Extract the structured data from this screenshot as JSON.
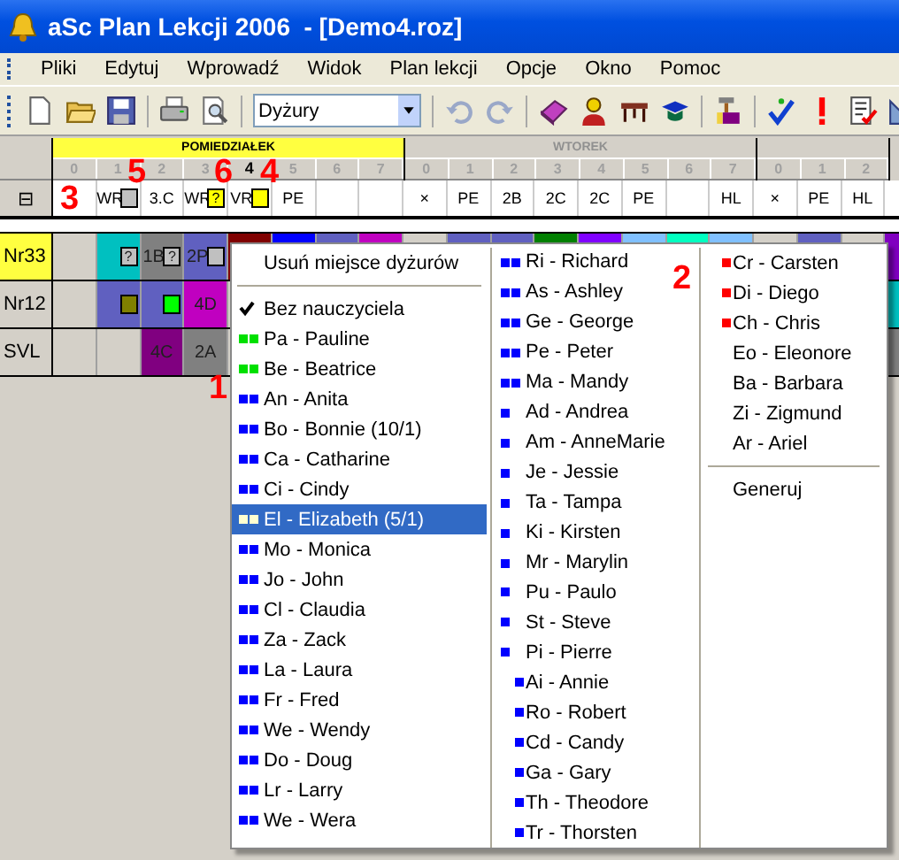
{
  "window": {
    "title": "aSc Plan Lekcji 2006  - [Demo4.roz]"
  },
  "menu_bar": [
    "Pliki",
    "Edytuj",
    "Wprowadź",
    "Widok",
    "Plan lekcji",
    "Opcje",
    "Okno",
    "Pomoc"
  ],
  "toolbar": {
    "view_select": {
      "value": "Dyżury"
    }
  },
  "days": [
    {
      "name": "POMIEDZIAŁEK",
      "selected": true,
      "periods": [
        {
          "label": "0",
          "selected": false
        },
        {
          "label": "1",
          "selected": false
        },
        {
          "label": "2",
          "selected": false
        },
        {
          "label": "3",
          "selected": false
        },
        {
          "label": "4",
          "selected": true
        },
        {
          "label": "5",
          "selected": false
        },
        {
          "label": "6",
          "selected": false
        },
        {
          "label": "7",
          "selected": false
        }
      ]
    },
    {
      "name": "WTOREK",
      "selected": false,
      "periods": [
        {
          "label": "0",
          "selected": false
        },
        {
          "label": "1",
          "selected": false
        },
        {
          "label": "2",
          "selected": false
        },
        {
          "label": "3",
          "selected": false
        },
        {
          "label": "4",
          "selected": false
        },
        {
          "label": "5",
          "selected": false
        },
        {
          "label": "6",
          "selected": false
        },
        {
          "label": "7",
          "selected": false
        }
      ]
    },
    {
      "selected": false,
      "periods": [
        {
          "label": "0",
          "selected": false
        },
        {
          "label": "1",
          "selected": false
        },
        {
          "label": "2",
          "selected": false
        }
      ]
    }
  ],
  "summary_row": {
    "toggle": "⊟",
    "cells": [
      null,
      {
        "text": "WR",
        "flag": {
          "color": "#c0c0c0"
        }
      },
      {
        "text": "3.C"
      },
      {
        "text": "WR",
        "flag": {
          "text": "?",
          "color": "#ffff00"
        }
      },
      {
        "text": "VR",
        "flag": {
          "color": "#ffff00"
        }
      },
      {
        "text": "PE"
      },
      null,
      null,
      {
        "text": "×"
      },
      {
        "text": "PE"
      },
      {
        "text": "2B"
      },
      {
        "text": "2C"
      },
      {
        "text": "2C"
      },
      {
        "text": "PE"
      },
      null,
      {
        "text": "HL"
      },
      {
        "text": "×"
      },
      {
        "text": "PE"
      },
      {
        "text": "HL"
      },
      null
    ]
  },
  "rows": [
    {
      "name": "Nr33",
      "selected": true,
      "cells": [
        {
          "color": "#d4d0c8"
        },
        {
          "color": "#00c0c0",
          "flag": {
            "text": "?",
            "color": "#c0c0c0"
          }
        },
        {
          "color": "#808080",
          "text": "1B",
          "flag": {
            "text": "?",
            "color": "#c0c0c0"
          }
        },
        {
          "color": "#6060c0",
          "text": "2P",
          "flag": {
            "color": "#c0c0c0"
          }
        },
        {
          "color": "#800000"
        },
        {
          "color": "#0000ff"
        },
        {
          "color": "#6060c0"
        },
        {
          "color": "#c000c0"
        },
        {
          "color": "#d4d0c8"
        },
        {
          "color": "#6060c0"
        },
        {
          "color": "#6060c0"
        },
        {
          "color": "#008000"
        },
        {
          "color": "#8000ff"
        },
        {
          "color": "#80c0ff"
        },
        {
          "color": "#00ffc0"
        },
        {
          "color": "#80c0ff"
        },
        {
          "color": "#d4d0c8"
        },
        {
          "color": "#6060c0"
        },
        {
          "color": "#d4d0c8"
        },
        {
          "color": "#8000c0"
        }
      ]
    },
    {
      "name": "Nr12",
      "selected": false,
      "cells": [
        {
          "color": "#d4d0c8"
        },
        {
          "color": "#6060c0",
          "flag": {
            "color": "#808000"
          }
        },
        {
          "color": "#6060c0",
          "flag": {
            "color": "#00ff00"
          }
        },
        {
          "color": "#c000c0",
          "text": "4D"
        },
        null,
        null,
        null,
        null,
        null,
        null,
        null,
        null,
        null,
        null,
        null,
        null,
        null,
        null,
        null,
        {
          "color": "#00c0c0"
        }
      ]
    },
    {
      "name": "SVL",
      "selected": false,
      "cells": [
        {
          "color": "#d4d0c8"
        },
        {
          "color": "#d4d0c8"
        },
        {
          "color": "#800080",
          "text": "4C"
        },
        {
          "color": "#808080",
          "text": "2A"
        },
        null,
        null,
        null,
        null,
        null,
        null,
        null,
        null,
        null,
        null,
        null,
        null,
        null,
        null,
        null,
        {
          "color": "#808080"
        }
      ]
    }
  ],
  "context_menu": {
    "columns": [
      {
        "items": [
          {
            "kind": "action",
            "label": "Usuń miejsce dyżurów"
          },
          {
            "kind": "separator"
          },
          {
            "kind": "check",
            "label": "Bez nauczyciela",
            "checked": true,
            "selected": false
          },
          {
            "kind": "double",
            "label": "Pa - Pauline",
            "color": "#00e000",
            "selected": false
          },
          {
            "kind": "double",
            "label": "Be - Beatrice",
            "color": "#00e000",
            "selected": false
          },
          {
            "kind": "double",
            "label": "An - Anita",
            "color": "#0000ff",
            "selected": false
          },
          {
            "kind": "double",
            "label": "Bo - Bonnie (10/1)",
            "color": "#0000ff",
            "selected": false
          },
          {
            "kind": "double",
            "label": "Ca - Catharine",
            "color": "#0000ff",
            "selected": false
          },
          {
            "kind": "double",
            "label": "Ci - Cindy",
            "color": "#0000ff",
            "selected": false
          },
          {
            "kind": "double",
            "label": "El - Elizabeth (5/1)",
            "color": "#ffffd0",
            "selected": true
          },
          {
            "kind": "double",
            "label": "Mo - Monica",
            "color": "#0000ff",
            "selected": false
          },
          {
            "kind": "double",
            "label": "Jo - John",
            "color": "#0000ff",
            "selected": false
          },
          {
            "kind": "double",
            "label": "Cl - Claudia",
            "color": "#0000ff",
            "selected": false
          },
          {
            "kind": "double",
            "label": "Za - Zack",
            "color": "#0000ff",
            "selected": false
          },
          {
            "kind": "double",
            "label": "La - Laura",
            "color": "#0000ff",
            "selected": false
          },
          {
            "kind": "double",
            "label": "Fr - Fred",
            "color": "#0000ff",
            "selected": false
          },
          {
            "kind": "double",
            "label": "We - Wendy",
            "color": "#0000ff",
            "selected": false
          },
          {
            "kind": "double",
            "label": "Do - Doug",
            "color": "#0000ff",
            "selected": false
          },
          {
            "kind": "double",
            "label": "Lr - Larry",
            "color": "#0000ff",
            "selected": false
          },
          {
            "kind": "double",
            "label": "We - Wera",
            "color": "#0000ff",
            "selected": false
          }
        ]
      },
      {
        "items": [
          {
            "kind": "double",
            "label": "Ri - Richard",
            "color": "#0000ff",
            "selected": false
          },
          {
            "kind": "double",
            "label": "As - Ashley",
            "color": "#0000ff",
            "selected": false
          },
          {
            "kind": "double",
            "label": "Ge - George",
            "color": "#0000ff",
            "selected": false
          },
          {
            "kind": "double",
            "label": "Pe - Peter",
            "color": "#0000ff",
            "selected": false
          },
          {
            "kind": "double",
            "label": "Ma - Mandy",
            "color": "#0000ff",
            "selected": false
          },
          {
            "kind": "single",
            "label": "Ad - Andrea",
            "color": "#0000ff",
            "selected": false
          },
          {
            "kind": "single",
            "label": "Am - AnneMarie",
            "color": "#0000ff",
            "selected": false
          },
          {
            "kind": "single",
            "label": "Je - Jessie",
            "color": "#0000ff",
            "selected": false
          },
          {
            "kind": "single",
            "label": "Ta - Tampa",
            "color": "#0000ff",
            "selected": false
          },
          {
            "kind": "single",
            "label": "Ki - Kirsten",
            "color": "#0000ff",
            "selected": false
          },
          {
            "kind": "single",
            "label": "Mr - Marylin",
            "color": "#0000ff",
            "selected": false
          },
          {
            "kind": "single",
            "label": "Pu - Paulo",
            "color": "#0000ff",
            "selected": false
          },
          {
            "kind": "single",
            "label": "St - Steve",
            "color": "#0000ff",
            "selected": false
          },
          {
            "kind": "single",
            "label": "Pi - Pierre",
            "color": "#0000ff",
            "selected": false
          },
          {
            "kind": "near",
            "label": "Ai - Annie",
            "color": "#0000ff",
            "selected": false
          },
          {
            "kind": "near",
            "label": "Ro - Robert",
            "color": "#0000ff",
            "selected": false
          },
          {
            "kind": "near",
            "label": "Cd - Candy",
            "color": "#0000ff",
            "selected": false
          },
          {
            "kind": "near",
            "label": "Ga - Gary",
            "color": "#0000ff",
            "selected": false
          },
          {
            "kind": "near",
            "label": "Th - Theodore",
            "color": "#0000ff",
            "selected": false
          },
          {
            "kind": "near",
            "label": "Tr - Thorsten",
            "color": "#0000ff",
            "selected": false
          }
        ]
      },
      {
        "items": [
          {
            "kind": "near",
            "label": "Cr - Carsten",
            "color": "#ff0000",
            "selected": false
          },
          {
            "kind": "near",
            "label": "Di - Diego",
            "color": "#ff0000",
            "selected": false
          },
          {
            "kind": "near",
            "label": "Ch - Chris",
            "color": "#ff0000",
            "selected": false
          },
          {
            "kind": "plain",
            "label": "Eo - Eleonore",
            "selected": false
          },
          {
            "kind": "plain",
            "label": "Ba - Barbara",
            "selected": false
          },
          {
            "kind": "plain",
            "label": "Zi - Zigmund",
            "selected": false
          },
          {
            "kind": "plain",
            "label": "Ar - Ariel",
            "selected": false
          },
          {
            "kind": "separator"
          },
          {
            "kind": "action",
            "label": "Generuj"
          }
        ]
      }
    ]
  },
  "annotations": [
    {
      "label": "5"
    },
    {
      "label": "6"
    },
    {
      "label": "4"
    },
    {
      "label": "3"
    },
    {
      "label": "1"
    },
    {
      "label": "2"
    }
  ]
}
